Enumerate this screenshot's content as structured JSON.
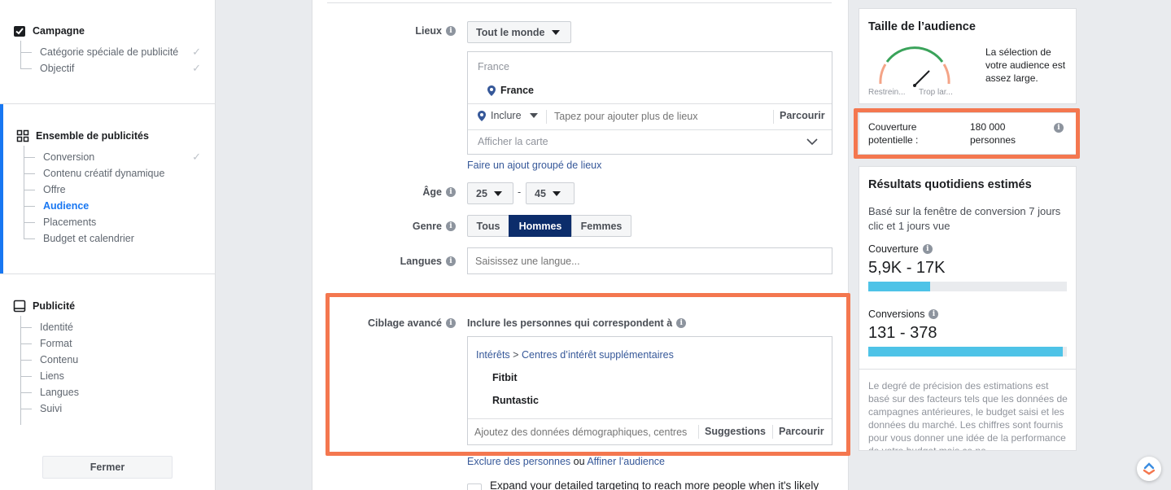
{
  "sidebar": {
    "campaign": {
      "title": "Campagne",
      "items": [
        {
          "label": "Catégorie spéciale de publicité"
        },
        {
          "label": "Objectif"
        }
      ]
    },
    "adset": {
      "title": "Ensemble de publicités",
      "items": [
        {
          "label": "Conversion"
        },
        {
          "label": "Contenu créatif dynamique"
        },
        {
          "label": "Offre"
        },
        {
          "label": "Audience"
        },
        {
          "label": "Placements"
        },
        {
          "label": "Budget et calendrier"
        }
      ]
    },
    "ad": {
      "title": "Publicité",
      "items": [
        {
          "label": "Identité"
        },
        {
          "label": "Format"
        },
        {
          "label": "Contenu"
        },
        {
          "label": "Liens"
        },
        {
          "label": "Langues"
        },
        {
          "label": "Suivi"
        }
      ]
    },
    "close_label": "Fermer"
  },
  "form": {
    "locations": {
      "label": "Lieux",
      "dropdown": "Tout le monde",
      "group_header": "France",
      "selected": "France",
      "include": "Inclure",
      "search_placeholder": "Tapez pour ajouter plus de lieux",
      "browse": "Parcourir",
      "map": "Afficher la carte",
      "bulk_link": "Faire un ajout groupé de lieux"
    },
    "age": {
      "label": "Âge",
      "min": "25",
      "max": "45",
      "sep": "-"
    },
    "gender": {
      "label": "Genre",
      "options": [
        "Tous",
        "Hommes",
        "Femmes"
      ],
      "selected": "Hommes"
    },
    "languages": {
      "label": "Langues",
      "placeholder": "Saisissez une langue..."
    },
    "detailed": {
      "label": "Ciblage avancé",
      "include_text": "Inclure les personnes qui correspondent à",
      "path_root": "Intérêts",
      "path_sep": ">",
      "path_leaf": "Centres d’intérêt supplémentaires",
      "interests": [
        "Fitbit",
        "Runtastic"
      ],
      "search_placeholder": "Ajoutez des données démographiques, centres",
      "suggestions": "Suggestions",
      "browse": "Parcourir",
      "exclude_link": "Exclure des personnes",
      "or_text": "ou",
      "narrow_link": "Affiner l’audience",
      "expand_text": "Expand your detailed targeting to reach more people when it's likely"
    }
  },
  "audience": {
    "title": "Taille de l’audience",
    "gauge_low": "Restrein...",
    "gauge_high": "Trop lar...",
    "description": "La sélection de votre audience est assez large.",
    "reach_label": "Couverture potentielle :",
    "reach_value": "180 000 personnes"
  },
  "daily": {
    "title": "Résultats quotidiens estimés",
    "based_on": "Basé sur la fenêtre de conversion 7 jours clic et 1 jours vue",
    "reach_label": "Couverture",
    "reach_value": "5,9K - 17K",
    "reach_fill": 0.31,
    "conv_label": "Conversions",
    "conv_value": "131 - 378",
    "conv_fill": 0.98,
    "disclaimer": "Le degré de précision des estimations est basé sur des facteurs tels que les données de campagnes antérieures, le budget saisi et les données du marché. Les chiffres sont fournis pour vous donner une idée de la performance de votre budget mais ce ne"
  },
  "colors": {
    "accent": "#1877f2",
    "highlight": "#f4774f",
    "bar": "#4ec3e7",
    "selected_button": "#0c2d6b"
  }
}
